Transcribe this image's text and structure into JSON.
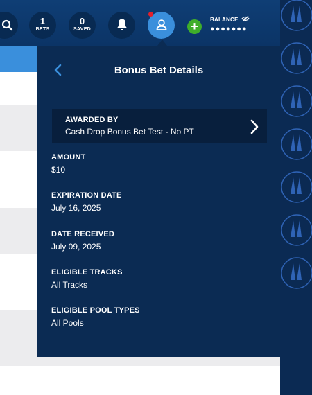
{
  "header": {
    "bets": {
      "count": "1",
      "label": "BETS"
    },
    "saved": {
      "count": "0",
      "label": "SAVED"
    },
    "balance": {
      "label": "BALANCE",
      "masked_value": "●●●●●●●"
    },
    "icons": [
      "search-icon",
      "bell-icon",
      "user-icon",
      "plus-icon",
      "eye-slash-icon"
    ]
  },
  "panel": {
    "title": "Bonus Bet Details",
    "awarded_by": {
      "label": "AWARDED BY",
      "value": "Cash Drop Bonus Bet Test - No PT"
    },
    "amount": {
      "label": "AMOUNT",
      "value": "$10"
    },
    "expiration_date": {
      "label": "EXPIRATION DATE",
      "value": "July 16, 2025"
    },
    "date_received": {
      "label": "DATE RECEIVED",
      "value": "July 09, 2025"
    },
    "eligible_tracks": {
      "label": "ELIGIBLE TRACKS",
      "value": "All Tracks"
    },
    "eligible_pool_types": {
      "label": "ELIGIBLE POOL TYPES",
      "value": "All Pools"
    }
  },
  "colors": {
    "header_bg": "#0f3e75",
    "panel_bg": "#0b2b53",
    "accent_blue": "#3a8fdc",
    "deposit_green": "#3fae2a",
    "notification_red": "#e2202b"
  }
}
